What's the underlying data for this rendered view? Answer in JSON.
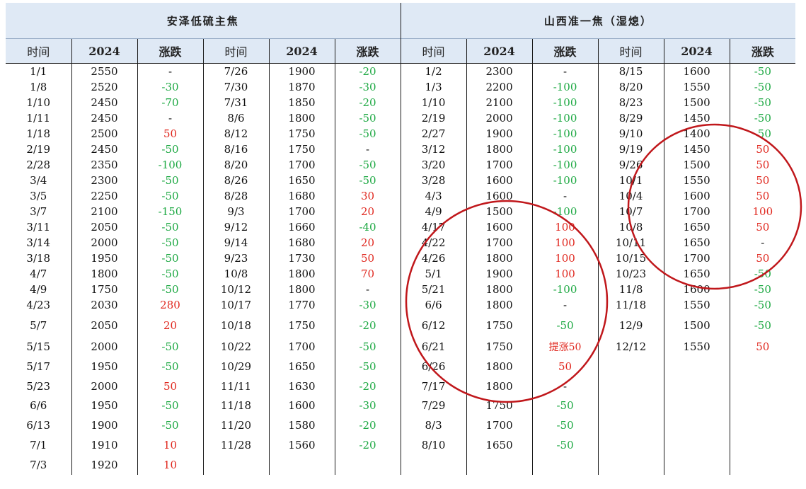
{
  "headers": {
    "left_title": "安泽低硫主焦",
    "right_title": "山西准一焦（湿熄）",
    "columns": [
      "时间",
      "2024",
      "涨跌",
      "时间",
      "2024",
      "涨跌",
      "时间",
      "2024",
      "涨跌",
      "时间",
      "2024",
      "涨跌"
    ]
  },
  "rows": [
    [
      "1/1",
      "2550",
      "-",
      "7/26",
      "1900",
      "-20",
      "1/2",
      "2300",
      "-",
      "8/15",
      "1600",
      "-50"
    ],
    [
      "1/8",
      "2520",
      "-30",
      "7/30",
      "1870",
      "-30",
      "1/3",
      "2200",
      "-100",
      "8/20",
      "1550",
      "-50"
    ],
    [
      "1/10",
      "2450",
      "-70",
      "7/31",
      "1850",
      "-20",
      "1/10",
      "2100",
      "-100",
      "8/23",
      "1500",
      "-50"
    ],
    [
      "1/11",
      "2450",
      "-",
      "8/6",
      "1800",
      "-50",
      "2/19",
      "2000",
      "-100",
      "8/29",
      "1450",
      "-50"
    ],
    [
      "1/18",
      "2500",
      "50",
      "8/12",
      "1750",
      "-50",
      "2/27",
      "1900",
      "-100",
      "9/10",
      "1400",
      "-50"
    ],
    [
      "2/19",
      "2450",
      "-50",
      "8/16",
      "1750",
      "-",
      "3/12",
      "1800",
      "-100",
      "9/19",
      "1450",
      "50"
    ],
    [
      "2/28",
      "2350",
      "-100",
      "8/20",
      "1700",
      "-50",
      "3/20",
      "1700",
      "-100",
      "9/26",
      "1500",
      "50"
    ],
    [
      "3/4",
      "2300",
      "-50",
      "8/26",
      "1650",
      "-50",
      "3/28",
      "1600",
      "-100",
      "10/1",
      "1550",
      "50"
    ],
    [
      "3/5",
      "2250",
      "-50",
      "8/28",
      "1680",
      "30",
      "4/3",
      "1600",
      "-",
      "10/4",
      "1600",
      "50"
    ],
    [
      "3/7",
      "2100",
      "-150",
      "9/3",
      "1700",
      "20",
      "4/9",
      "1500",
      "-100",
      "10/7",
      "1700",
      "100"
    ],
    [
      "3/11",
      "2050",
      "-50",
      "9/12",
      "1660",
      "-40",
      "4/17",
      "1600",
      "100",
      "10/8",
      "1650",
      "50"
    ],
    [
      "3/14",
      "2000",
      "-50",
      "9/14",
      "1680",
      "20",
      "4/22",
      "1700",
      "100",
      "10/11",
      "1650",
      "-"
    ],
    [
      "3/18",
      "1950",
      "-50",
      "9/23",
      "1730",
      "50",
      "4/26",
      "1800",
      "100",
      "10/15",
      "1700",
      "50"
    ],
    [
      "4/7",
      "1800",
      "-50",
      "10/8",
      "1800",
      "70",
      "5/1",
      "1900",
      "100",
      "10/23",
      "1650",
      "-50"
    ],
    [
      "4/9",
      "1750",
      "-50",
      "10/12",
      "1800",
      "-",
      "5/21",
      "1800",
      "-100",
      "11/8",
      "1600",
      "-50"
    ],
    [
      "4/23",
      "2030",
      "280",
      "10/17",
      "1770",
      "-30",
      "6/6",
      "1800",
      "-",
      "11/18",
      "1550",
      "-50"
    ],
    [
      "5/7",
      "2050",
      "20",
      "10/18",
      "1750",
      "-20",
      "6/12",
      "1750",
      "-50",
      "12/9",
      "1500",
      "-50"
    ],
    [
      "5/15",
      "2000",
      "-50",
      "10/22",
      "1700",
      "-50",
      "6/21",
      "1750",
      "提涨50",
      "12/12",
      "1550",
      "50"
    ],
    [
      "5/17",
      "1950",
      "-50",
      "10/29",
      "1650",
      "-50",
      "6/26",
      "1800",
      "50",
      "",
      "",
      ""
    ],
    [
      "5/23",
      "2000",
      "50",
      "11/11",
      "1630",
      "-20",
      "7/17",
      "1800",
      "-",
      "",
      "",
      ""
    ],
    [
      "6/6",
      "1950",
      "-50",
      "11/18",
      "1600",
      "-30",
      "7/29",
      "1750",
      "-50",
      "",
      "",
      ""
    ],
    [
      "6/13",
      "1900",
      "-50",
      "11/20",
      "1580",
      "-20",
      "8/3",
      "1700",
      "-50",
      "",
      "",
      ""
    ],
    [
      "7/1",
      "1910",
      "10",
      "11/28",
      "1560",
      "-20",
      "8/10",
      "1650",
      "-50",
      "",
      "",
      ""
    ],
    [
      "7/3",
      "1920",
      "10",
      "",
      "",
      "",
      "",
      "",
      "",
      "",
      "",
      ""
    ]
  ],
  "colors": {
    "up": "#e0281f",
    "down": "#1ca842",
    "header_bg": "#dfe9f5",
    "circle": "#c0171b"
  }
}
